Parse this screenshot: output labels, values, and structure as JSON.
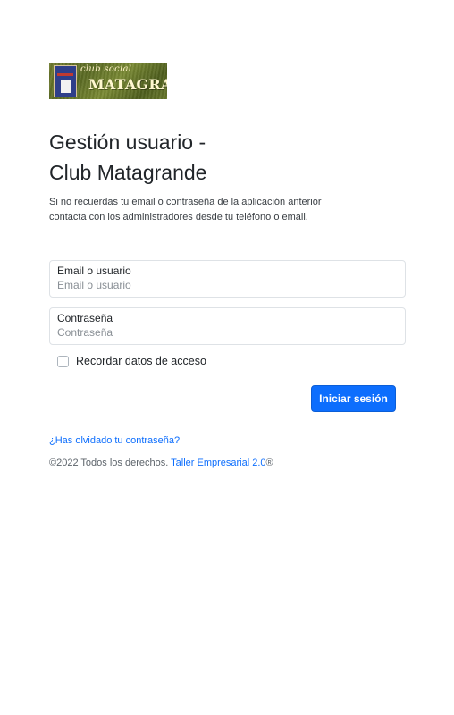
{
  "logo": {
    "subtitle": "club social",
    "name": "MATAGRANDE"
  },
  "header": {
    "title_line1": "Gestión usuario -",
    "title_line2": "Club Matagrande"
  },
  "description": "Si no recuerdas tu email o contraseña de la aplicación anterior contacta con los administradores desde tu teléfono o email.",
  "form": {
    "email_label": "Email o usuario",
    "email_placeholder": "Email o usuario",
    "email_value": "",
    "password_label": "Contraseña",
    "password_placeholder": "Contraseña",
    "password_value": "",
    "remember_label": "Recordar datos de acceso",
    "remember_checked": false,
    "submit_label": "Iniciar sesión"
  },
  "links": {
    "forgot_password": "¿Has olvidado tu contraseña?"
  },
  "footer": {
    "copyright": "©2022 Todos los derechos.",
    "company_link": "Taller Empresarial 2.0",
    "trademark": "®"
  },
  "colors": {
    "primary": "#0d6efd",
    "text": "#212529",
    "border": "#dee2e6"
  }
}
